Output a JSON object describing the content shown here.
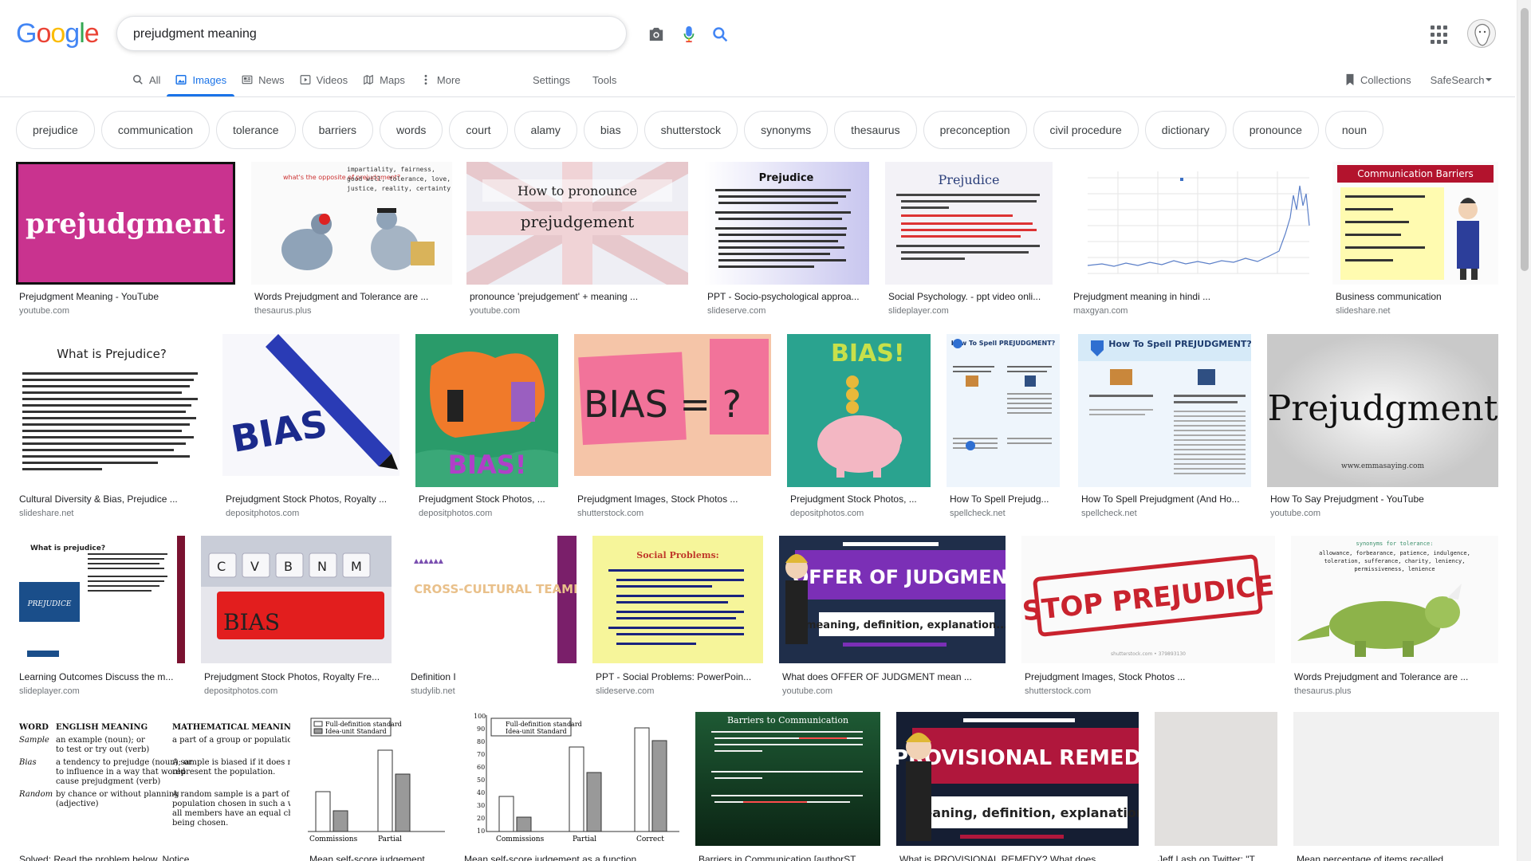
{
  "logo": {
    "letters": [
      "G",
      "o",
      "o",
      "g",
      "l",
      "e"
    ]
  },
  "search": {
    "query": "prejudgment meaning"
  },
  "tabs": [
    {
      "label": "All",
      "active": false
    },
    {
      "label": "Images",
      "active": true
    },
    {
      "label": "News",
      "active": false
    },
    {
      "label": "Videos",
      "active": false
    },
    {
      "label": "Maps",
      "active": false
    },
    {
      "label": "More",
      "active": false
    }
  ],
  "tools": {
    "settings": "Settings",
    "tools": "Tools"
  },
  "right": {
    "collections": "Collections",
    "safesearch": "SafeSearch"
  },
  "chips": [
    "prejudice",
    "communication",
    "tolerance",
    "barriers",
    "words",
    "court",
    "alamy",
    "bias",
    "shutterstock",
    "synonyms",
    "thesaurus",
    "preconception",
    "civil procedure",
    "dictionary",
    "pronounce",
    "noun"
  ],
  "results": [
    {
      "caption": "Prejudgment Meaning - YouTube",
      "source": "youtube.com",
      "thumb_text": "prejudgment"
    },
    {
      "caption": "Words Prejudgment and Tolerance are ...",
      "source": "thesaurus.plus",
      "thumb_text": "what's the opposite of prejudgment?"
    },
    {
      "caption": "pronounce 'prejudgement' + meaning ...",
      "source": "youtube.com",
      "thumb_text": "How to pronounce prejudgement"
    },
    {
      "caption": "PPT - Socio-psychological approa...",
      "source": "slideserve.com",
      "thumb_text": "Prejudice"
    },
    {
      "caption": "Social Psychology. - ppt video onli...",
      "source": "slideplayer.com",
      "thumb_text": "Prejudice"
    },
    {
      "caption": "Prejudgment meaning in hindi ...",
      "source": "maxgyan.com",
      "thumb_text": ""
    },
    {
      "caption": "Business communication",
      "source": "slideshare.net",
      "thumb_text": "Communication Barriers"
    },
    {
      "caption": "Cultural Diversity & Bias, Prejudice ...",
      "source": "slideshare.net",
      "thumb_text": "What is Prejudice?"
    },
    {
      "caption": "Prejudgment Stock Photos, Royalty ...",
      "source": "depositphotos.com",
      "thumb_text": "BIAS"
    },
    {
      "caption": "Prejudgment Stock Photos, ...",
      "source": "depositphotos.com",
      "thumb_text": "BIAS!"
    },
    {
      "caption": "Prejudgment Images, Stock Photos ...",
      "source": "shutterstock.com",
      "thumb_text": "BIAS = ?"
    },
    {
      "caption": "Prejudgment Stock Photos, ...",
      "source": "depositphotos.com",
      "thumb_text": "BIAS!"
    },
    {
      "caption": "How To Spell Prejudg...",
      "source": "spellcheck.net",
      "thumb_text": "How To Spell PREJUDGMENT?"
    },
    {
      "caption": "How To Spell Prejudgment (And Ho...",
      "source": "spellcheck.net",
      "thumb_text": "How To Spell PREJUDGMENT?"
    },
    {
      "caption": "How To Say Prejudgment - YouTube",
      "source": "youtube.com",
      "thumb_text": "Prejudgment"
    },
    {
      "caption": "Learning Outcomes Discuss the m...",
      "source": "slideplayer.com",
      "thumb_text": "What is prejudice?"
    },
    {
      "caption": "Prejudgment Stock Photos, Royalty Fre...",
      "source": "depositphotos.com",
      "thumb_text": "BIAS"
    },
    {
      "caption": "Definition I",
      "source": "studylib.net",
      "thumb_text": "CROSS-CULTURAL TEAMBUILDING"
    },
    {
      "caption": "PPT - Social Problems: PowerPoin...",
      "source": "slideserve.com",
      "thumb_text": "Social Problems:"
    },
    {
      "caption": "What does OFFER OF JUDGMENT mean ...",
      "source": "youtube.com",
      "thumb_text": "OFFER OF JUDGMENT"
    },
    {
      "caption": "Prejudgment Images, Stock Photos ...",
      "source": "shutterstock.com",
      "thumb_text": "STOP PREJUDICE"
    },
    {
      "caption": "Words Prejudgment and Tolerance are ...",
      "source": "thesaurus.plus",
      "thumb_text": "synonyms for tolerance:"
    },
    {
      "caption": "Solved: Read the problem below. Notice...",
      "source": "",
      "thumb_text": "WORD"
    },
    {
      "caption": "Mean self-score judgement ...",
      "source": "",
      "thumb_text": ""
    },
    {
      "caption": "Mean self-score judgement as a function ...",
      "source": "",
      "thumb_text": ""
    },
    {
      "caption": "Barriers in Communication [authorST...",
      "source": "",
      "thumb_text": "Barriers to Communication"
    },
    {
      "caption": "What is PROVISIONAL REMEDY? What does ...",
      "source": "",
      "thumb_text": "PROVISIONAL REMEDY"
    },
    {
      "caption": "Jeff Lash on Twitter: \"T...",
      "source": "",
      "thumb_text": ""
    },
    {
      "caption": "Mean percentage of items recalled ...",
      "source": "",
      "thumb_text": ""
    }
  ]
}
